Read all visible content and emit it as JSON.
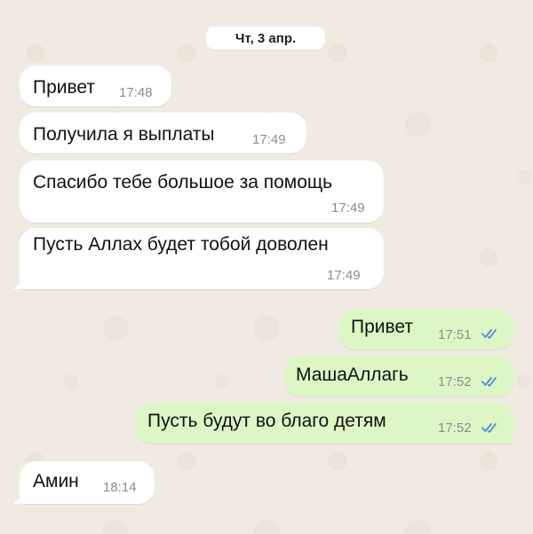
{
  "date_label": "Чт, 3 апр.",
  "messages": [
    {
      "direction": "in",
      "text": "Привет",
      "time": "17:48"
    },
    {
      "direction": "in",
      "text": "Получила я выплаты",
      "time": "17:49"
    },
    {
      "direction": "in",
      "text": "Спасибо тебе большое за помощь",
      "time": "17:49"
    },
    {
      "direction": "in",
      "text": "Пусть Аллах будет тобой доволен",
      "time": "17:49"
    },
    {
      "direction": "out",
      "text": "Привет",
      "time": "17:51",
      "status": "read"
    },
    {
      "direction": "out",
      "text": "МашаАллагь",
      "time": "17:52",
      "status": "read"
    },
    {
      "direction": "out",
      "text": "Пусть будут во благо детям",
      "time": "17:52",
      "status": "read"
    },
    {
      "direction": "in",
      "text": "Амин",
      "time": "18:14"
    }
  ],
  "colors": {
    "wallpaper": "#f0ebe2",
    "incoming_bubble": "#ffffff",
    "outgoing_bubble": "#dcf7c5",
    "read_check": "#4e8cd6",
    "timestamp": "#8c8c8c"
  },
  "icons": {
    "read_receipt": "double-check-icon"
  }
}
